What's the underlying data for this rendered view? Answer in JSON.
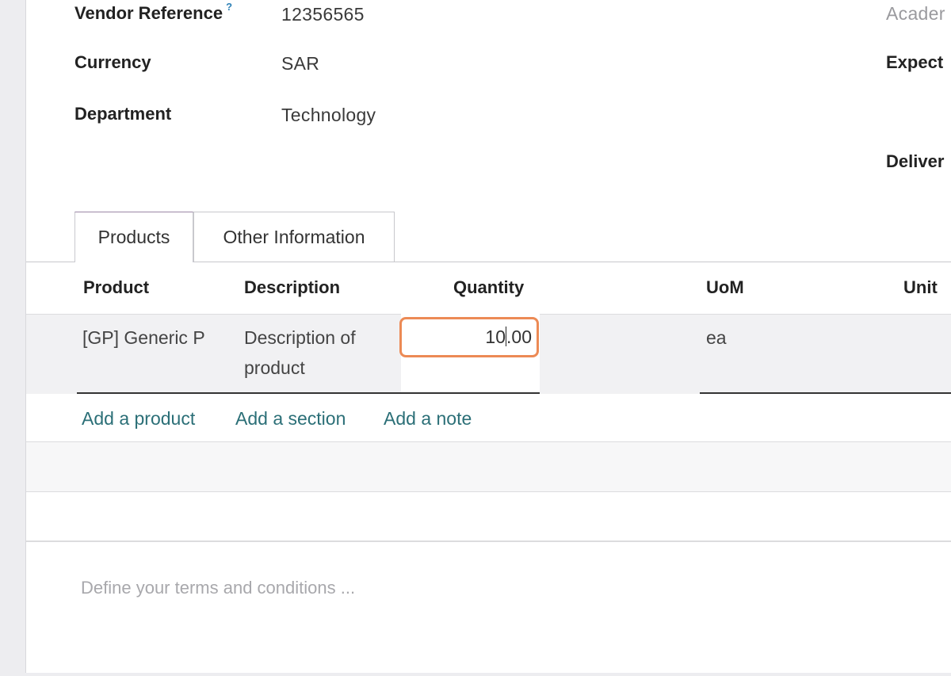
{
  "header_fields": {
    "vendor_reference_label": "Vendor Reference",
    "vendor_reference_help": "?",
    "vendor_reference_value": "12356565",
    "currency_label": "Currency",
    "currency_value": "SAR",
    "department_label": "Department",
    "department_value": "Technology"
  },
  "right_column": {
    "academy_label": "Acader",
    "expected_label": "Expect",
    "delivery_label": "Deliver"
  },
  "tabs": [
    {
      "label": "Products",
      "active": true
    },
    {
      "label": "Other Information",
      "active": false
    }
  ],
  "table": {
    "columns": [
      "Product",
      "Description",
      "Quantity",
      "UoM",
      "Unit"
    ],
    "rows": [
      {
        "product": "[GP] Generic P",
        "description_line1": "Description of",
        "description_line2": "product",
        "quantity_before_caret": "10",
        "quantity_after_caret": ".00",
        "uom": "ea"
      }
    ]
  },
  "actions": {
    "add_product": "Add a product",
    "add_section": "Add a section",
    "add_note": "Add a note"
  },
  "terms": {
    "placeholder": "Define your terms and conditions ..."
  },
  "colors": {
    "link": "#2b6f77",
    "focus_border": "#ec8a55",
    "row_background": "#f1f1f3",
    "help_icon": "#2f82b7"
  }
}
